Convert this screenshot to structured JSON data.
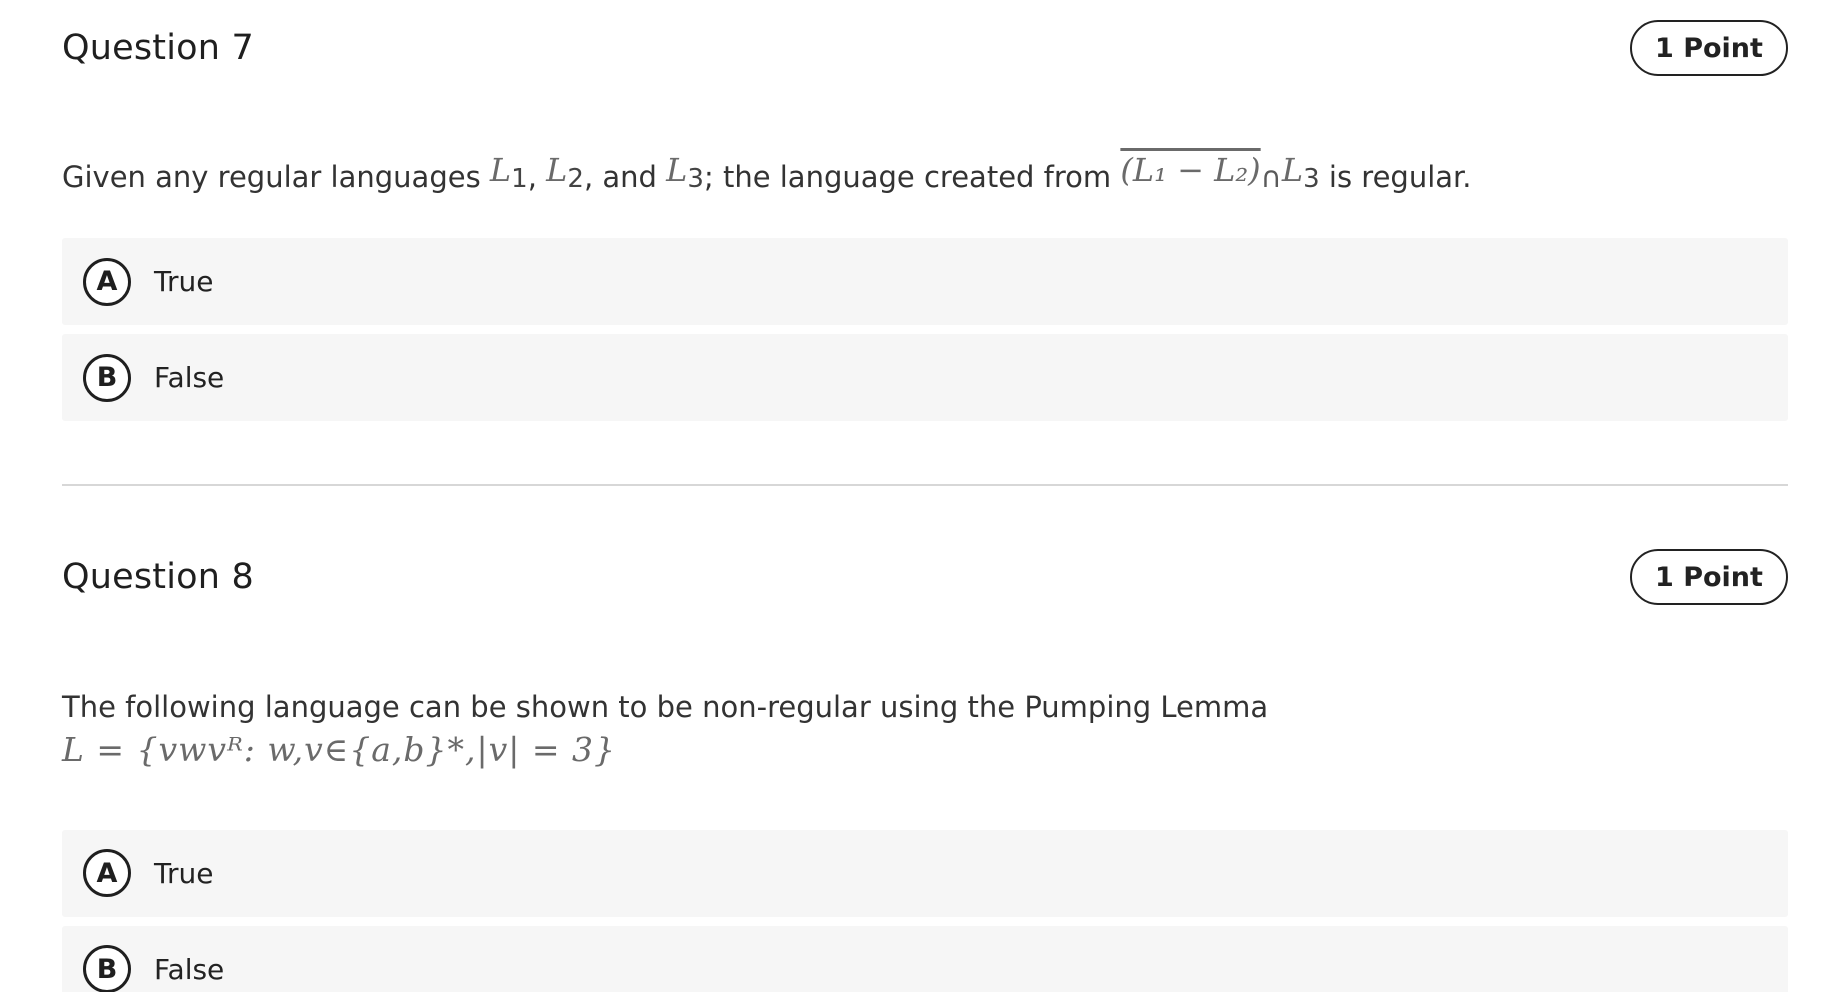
{
  "questions": [
    {
      "title": "Question 7",
      "points": "1 Point",
      "prompt": {
        "p1": "Given any regular languages ",
        "l1": "L",
        "s1": "1",
        "c1": ", ",
        "l2": "L",
        "s2": "2",
        "c2": ", and ",
        "l3": "L",
        "s3": "3",
        "p2": "; the language created from ",
        "expr": "(L₁ − L₂)",
        "cap": "∩",
        "l4": "L",
        "s4": "3",
        "p3": " is regular."
      },
      "options": [
        {
          "letter": "A",
          "label": "True"
        },
        {
          "letter": "B",
          "label": "False"
        }
      ]
    },
    {
      "title": "Question 8",
      "points": "1 Point",
      "prompt_text": "The following language can be shown to be non-regular using the Pumping Lemma",
      "formula": "L = {vwvᴿ: w,v∈{a,b}*,|v| = 3}",
      "options": [
        {
          "letter": "A",
          "label": "True"
        },
        {
          "letter": "B",
          "label": "False"
        }
      ]
    }
  ]
}
